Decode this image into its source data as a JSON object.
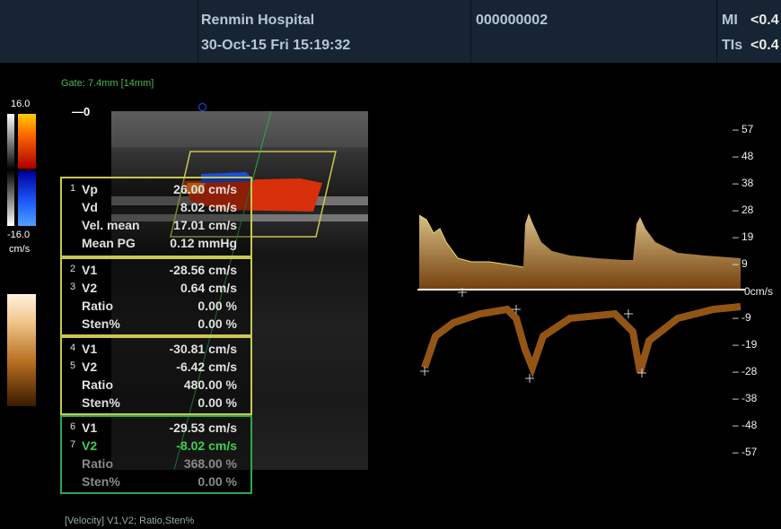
{
  "header": {
    "hospital": "Renmin Hospital",
    "datetime": "30-Oct-15 Fri 15:19:32",
    "patient_id": "000000002",
    "mi_label": "MI",
    "mi_value": "<0.4",
    "tis_label": "TIs",
    "tis_value": "<0.4"
  },
  "gate": "Gate: 7.4mm [14mm]",
  "depth_top": "0",
  "color_scale": {
    "max": "16.0",
    "min": "-16.0",
    "unit": "cm/s"
  },
  "measurements": {
    "box1": [
      {
        "num": "1",
        "label": "Vp",
        "value": "26.00 cm/s"
      },
      {
        "num": "",
        "label": "Vd",
        "value": "8.02 cm/s"
      },
      {
        "num": "",
        "label": "Vel. mean",
        "value": "17.01 cm/s"
      },
      {
        "num": "",
        "label": "Mean PG",
        "value": "0.12 mmHg"
      }
    ],
    "box2": [
      {
        "num": "2",
        "label": "V1",
        "value": "-28.56 cm/s"
      },
      {
        "num": "3",
        "label": "V2",
        "value": "0.64 cm/s"
      },
      {
        "num": "",
        "label": "Ratio",
        "value": "0.00 %"
      },
      {
        "num": "",
        "label": "Sten%",
        "value": "0.00 %"
      }
    ],
    "box3": [
      {
        "num": "4",
        "label": "V1",
        "value": "-30.81 cm/s"
      },
      {
        "num": "5",
        "label": "V2",
        "value": "-6.42 cm/s"
      },
      {
        "num": "",
        "label": "Ratio",
        "value": "480.00 %"
      },
      {
        "num": "",
        "label": "Sten%",
        "value": "0.00 %"
      }
    ],
    "box4": [
      {
        "num": "6",
        "label": "V1",
        "value": "-29.53 cm/s"
      },
      {
        "num": "7",
        "label": "V2",
        "value": "-8.02 cm/s"
      },
      {
        "num": "",
        "label": "Ratio",
        "value": "368.00 %"
      },
      {
        "num": "",
        "label": "Sten%",
        "value": "0.00 %"
      }
    ]
  },
  "velocity_scale": [
    "57",
    "48",
    "38",
    "28",
    "19",
    "9",
    "0cm/s",
    "-9",
    "-19",
    "-28",
    "-38",
    "-48",
    "-57"
  ],
  "footer": "[Velocity] V1,V2;    Ratio,Sten%"
}
